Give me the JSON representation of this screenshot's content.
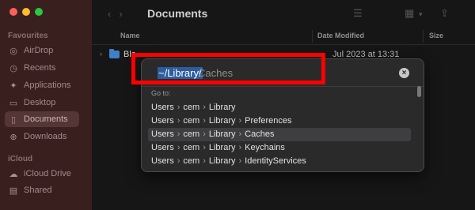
{
  "window": {
    "title": "Documents"
  },
  "traffic_lights": {
    "close": "#ff5f57",
    "minimize": "#febc2e",
    "zoom": "#28c840"
  },
  "sidebar": {
    "favourites_label": "Favourites",
    "items": [
      {
        "label": "AirDrop",
        "icon": "airdrop-icon"
      },
      {
        "label": "Recents",
        "icon": "clock-icon"
      },
      {
        "label": "Applications",
        "icon": "applications-icon"
      },
      {
        "label": "Desktop",
        "icon": "desktop-icon"
      },
      {
        "label": "Documents",
        "icon": "document-icon"
      },
      {
        "label": "Downloads",
        "icon": "download-icon"
      }
    ],
    "icloud_label": "iCloud",
    "icloud_items": [
      {
        "label": "iCloud Drive",
        "icon": "cloud-icon"
      },
      {
        "label": "Shared",
        "icon": "shared-folder-icon"
      }
    ]
  },
  "columns": {
    "name": "Name",
    "date_modified": "Date Modified",
    "size": "Size"
  },
  "file_row": {
    "name": "Bla",
    "date": "Jul 2023 at 13:31"
  },
  "goto": {
    "selected_text": "~/Library/",
    "rest_text": "Caches",
    "section_label": "Go to:",
    "suggestions": [
      [
        "Users",
        "cem",
        "Library"
      ],
      [
        "Users",
        "cem",
        "Library",
        "Preferences"
      ],
      [
        "Users",
        "cem",
        "Library",
        "Caches"
      ],
      [
        "Users",
        "cem",
        "Library",
        "Keychains"
      ],
      [
        "Users",
        "cem",
        "Library",
        "IdentityServices"
      ]
    ],
    "highlighted_index": 2
  },
  "colors": {
    "accent_red": "#ff0000",
    "selection": "#2e5c9e"
  }
}
